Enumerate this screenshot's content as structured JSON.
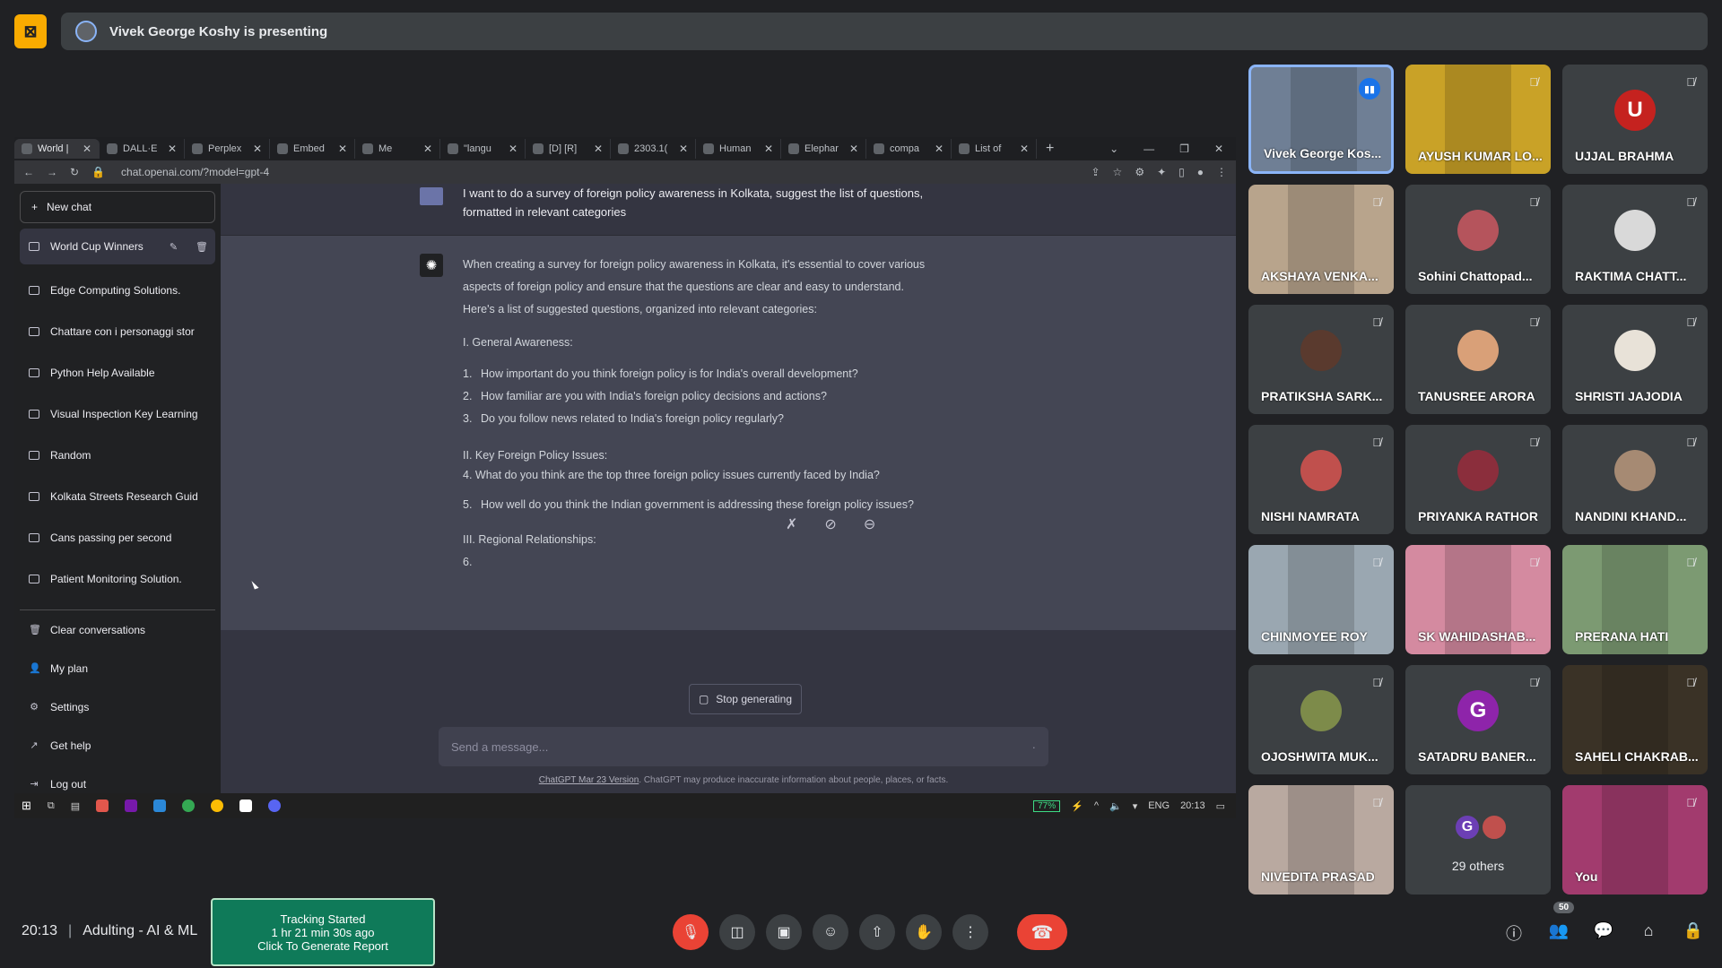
{
  "presenting": {
    "text": "Vivek George Koshy is presenting"
  },
  "browser": {
    "tabs": [
      {
        "label": "World |",
        "active": true
      },
      {
        "label": "DALL·E"
      },
      {
        "label": "Perplex"
      },
      {
        "label": "Embed"
      },
      {
        "label": "Me"
      },
      {
        "label": "\"langu"
      },
      {
        "label": "[D] [R]"
      },
      {
        "label": "2303.1("
      },
      {
        "label": "Human"
      },
      {
        "label": "Elephar"
      },
      {
        "label": "compa"
      },
      {
        "label": "List of"
      }
    ],
    "url": "chat.openai.com/?model=gpt-4"
  },
  "chatgpt": {
    "new_chat": "New chat",
    "history": [
      "World Cup Winners",
      "Edge Computing Solutions.",
      "Chattare con i personaggi stor",
      "Python Help Available",
      "Visual Inspection Key Learning",
      "Random",
      "Kolkata Streets Research Guid",
      "Cans passing per second",
      "Patient Monitoring Solution."
    ],
    "menu": [
      {
        "label": "Clear conversations",
        "icon": "trash-icon"
      },
      {
        "label": "My plan",
        "icon": "user-icon"
      },
      {
        "label": "Settings",
        "icon": "gear-icon"
      },
      {
        "label": "Get help",
        "icon": "external-link-icon"
      },
      {
        "label": "Log out",
        "icon": "logout-icon"
      }
    ],
    "user_message": "I want to do a survey of foreign policy awareness in Kolkata, suggest the list of questions, formatted in relevant categories",
    "assistant": {
      "intro1": "When creating a survey for foreign policy awareness in Kolkata, it's essential to cover various",
      "intro2": "aspects of foreign policy and ensure that the questions are clear and easy to understand.",
      "intro3": "Here's a list of suggested questions, organized into relevant categories:",
      "sec1": "I. General Awareness:",
      "q1n": "1.",
      "q1": "How important do you think foreign policy is for India's overall development?",
      "q2n": "2.",
      "q2": "How familiar are you with India's foreign policy decisions and actions?",
      "q3n": "3.",
      "q3": "Do you follow news related to India's foreign policy regularly?",
      "sec2": "II. Key Foreign Policy Issues:",
      "q4": "4. What do you think are the top three foreign policy issues currently faced by India?",
      "q5n": "5.",
      "q5": "How well do you think the Indian government is addressing these foreign policy issues?",
      "sec3": "III. Regional Relationships:",
      "q6": "6."
    },
    "stop_generating": "Stop generating",
    "input_placeholder": "Send a message...",
    "disclaimer_link": "ChatGPT Mar 23 Version",
    "disclaimer_text": ". ChatGPT may produce inaccurate information about people, places, or facts."
  },
  "taskbar": {
    "battery": "77%",
    "lang": "ENG",
    "time": "20:13"
  },
  "participants": [
    {
      "name": "Vivek George Kos...",
      "type": "video",
      "speaking": true,
      "color": "#6f7f95"
    },
    {
      "name": "AYUSH KUMAR LO...",
      "type": "video",
      "color": "#c9a227"
    },
    {
      "name": "UJJAL BRAHMA",
      "type": "letter",
      "letter": "U",
      "color": "#c5221f"
    },
    {
      "name": "AKSHAYA VENKA...",
      "type": "video",
      "color": "#b8a48c"
    },
    {
      "name": "Sohini Chattopad...",
      "type": "photo",
      "color": "#b5545c"
    },
    {
      "name": "RAKTIMA CHATT...",
      "type": "photo",
      "color": "#d9d9d9"
    },
    {
      "name": "PRATIKSHA SARK...",
      "type": "photo",
      "color": "#5a3a2e"
    },
    {
      "name": "TANUSREE ARORA",
      "type": "photo",
      "color": "#d9a078"
    },
    {
      "name": "SHRISTI JAJODIA",
      "type": "photo",
      "color": "#e8e2d8"
    },
    {
      "name": "NISHI NAMRATA",
      "type": "photo",
      "color": "#c0504d"
    },
    {
      "name": "PRIYANKA RATHOR",
      "type": "photo",
      "color": "#8b2e3c"
    },
    {
      "name": "NANDINI KHAND...",
      "type": "photo",
      "color": "#a68a73"
    },
    {
      "name": "CHINMOYEE ROY",
      "type": "video",
      "color": "#9aa7b1"
    },
    {
      "name": "SK WAHIDASHAB...",
      "type": "video",
      "color": "#d48aa0"
    },
    {
      "name": "PRERANA HATI",
      "type": "video",
      "color": "#7c9a72"
    },
    {
      "name": "OJOSHWITA MUK...",
      "type": "photo",
      "color": "#7d8b4a"
    },
    {
      "name": "SATADRU BANER...",
      "type": "letter",
      "letter": "G",
      "color": "#8e24aa"
    },
    {
      "name": "SAHELI CHAKRAB...",
      "type": "video",
      "color": "#3a3226"
    },
    {
      "name": "NIVEDITA PRASAD",
      "type": "video",
      "color": "#b9a9a0"
    },
    {
      "name": "29 others",
      "type": "others"
    },
    {
      "name": "You",
      "type": "video",
      "color": "#a23b6e"
    }
  ],
  "others_mini": [
    {
      "letter": "G",
      "color": "#6c3fb5"
    },
    {
      "letter": "",
      "color": "#c0504d"
    }
  ],
  "bottom": {
    "time": "20:13",
    "meeting": "Adulting - AI & ML",
    "tracking_line1": "Tracking Started",
    "tracking_line2": "1 hr 21 min 30s ago",
    "tracking_line3": "Click To Generate Report",
    "people_count": "50"
  },
  "colors": {
    "accent": "#8ab4f8",
    "danger": "#ea4335",
    "present": "#f9ab00"
  }
}
